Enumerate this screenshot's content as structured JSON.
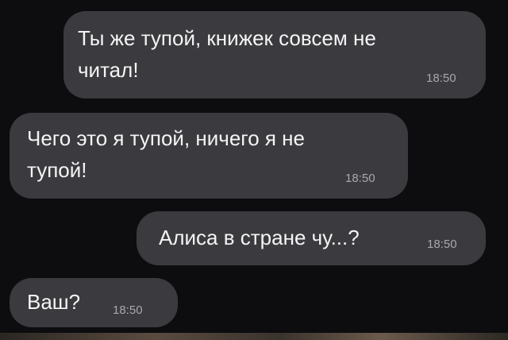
{
  "messages": [
    {
      "direction": "outgoing",
      "lines": [
        "Ты же тупой, книжек совсем не",
        "читал!"
      ],
      "time": "18:50"
    },
    {
      "direction": "incoming",
      "lines": [
        "Чего это я тупой, ничего я не",
        "тупой!"
      ],
      "time": "18:50"
    },
    {
      "direction": "outgoing",
      "lines": [
        "Алиса в стране чу...?"
      ],
      "time": "18:50"
    },
    {
      "direction": "incoming",
      "lines": [
        "Ваш?"
      ],
      "time": "18:50"
    }
  ],
  "colors": {
    "background": "#0d0d0f",
    "bubble": "#3b3b3f",
    "text": "#f4f4f4",
    "time": "#a8a8ac"
  }
}
